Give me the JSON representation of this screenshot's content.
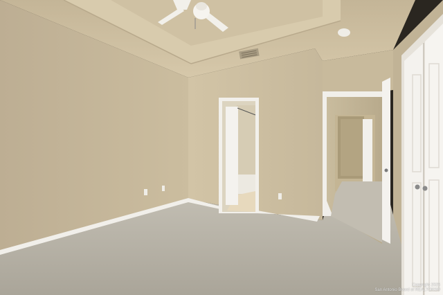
{
  "photo": {
    "subject": "empty bedroom interior",
    "watermark": {
      "line1": "Copyright 2025",
      "line2": "San Antonio Board of REALTORS®"
    }
  },
  "palette": {
    "wall_left": "#c4b69b",
    "wall_back": "#cbbd9f",
    "ceiling": "#cec0a2",
    "floor": "#b8b3a7",
    "trim": "#f3f1ec",
    "door": "#f4f2ee"
  }
}
